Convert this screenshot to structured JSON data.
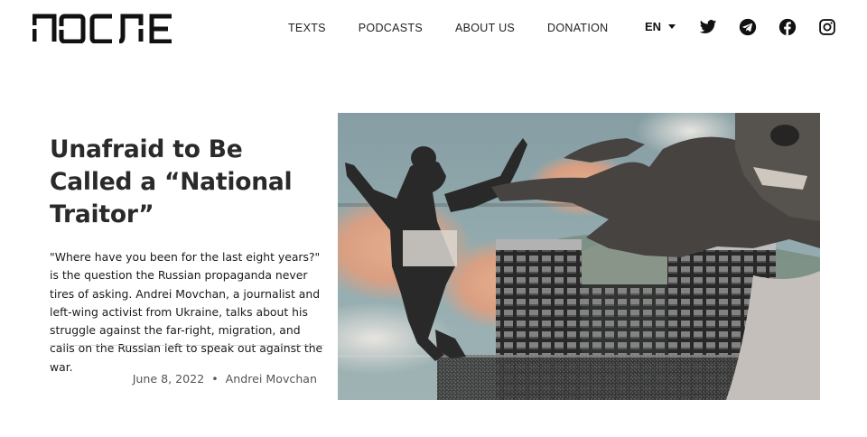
{
  "header": {
    "logo_text": "ПОСЛЕ",
    "nav": [
      {
        "label": "TEXTS"
      },
      {
        "label": "PODCASTS"
      },
      {
        "label": "ABOUT US"
      },
      {
        "label": "DONATION"
      }
    ],
    "language": "EN",
    "social": [
      "twitter-icon",
      "telegram-icon",
      "facebook-icon",
      "instagram-icon"
    ]
  },
  "article": {
    "title": "Unafraid to Be Called a “National Traitor”",
    "lede": "\"Where have you been for the last eight years?\" is the question the Russian propaganda never tires of asking. Andrei Movchan, a journalist and left-wing activist from Ukraine, talks about his struggle against the far-right, migration, and calls on the Russian left to speak out against the war.",
    "date": "June 8, 2022",
    "separator": "•",
    "author": "Andrei Movchan"
  }
}
